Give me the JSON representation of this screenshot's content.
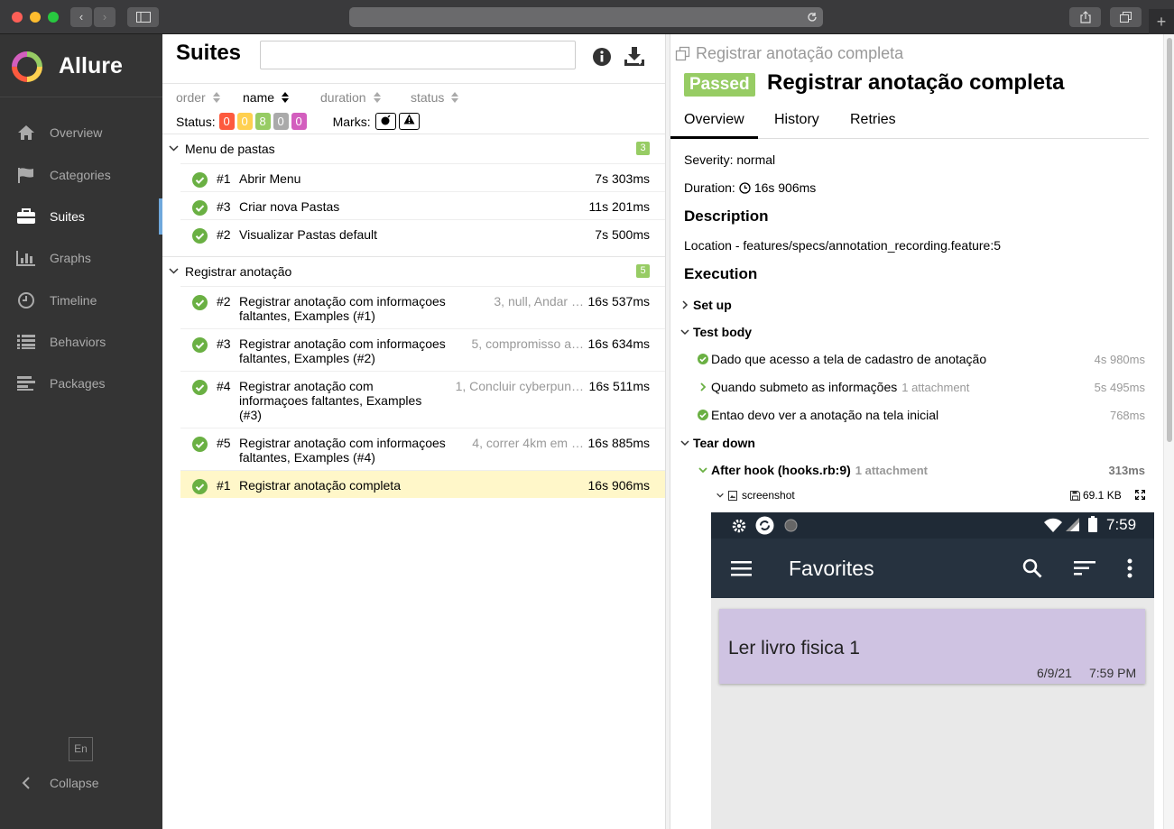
{
  "sidebar": {
    "app_name": "Allure",
    "items": [
      {
        "label": "Overview",
        "icon": "home-icon"
      },
      {
        "label": "Categories",
        "icon": "flag-icon"
      },
      {
        "label": "Suites",
        "icon": "briefcase-icon"
      },
      {
        "label": "Graphs",
        "icon": "bar-chart-icon"
      },
      {
        "label": "Timeline",
        "icon": "clock-icon"
      },
      {
        "label": "Behaviors",
        "icon": "list-icon"
      },
      {
        "label": "Packages",
        "icon": "align-left-icon"
      }
    ],
    "active": "Suites",
    "lang": "En",
    "collapse": "Collapse"
  },
  "suites": {
    "title": "Suites",
    "search_value": "",
    "sort": {
      "order": "order",
      "name": "name",
      "duration": "duration",
      "status": "status"
    },
    "status_label": "Status:",
    "status_counts": [
      {
        "value": "0",
        "color": "#fd5a3e"
      },
      {
        "value": "0",
        "color": "#ffd050"
      },
      {
        "value": "8",
        "color": "#97cc64"
      },
      {
        "value": "0",
        "color": "#aaaaaa"
      },
      {
        "value": "0",
        "color": "#d35ebe"
      }
    ],
    "marks_label": "Marks:",
    "groups": [
      {
        "name": "Menu de pastas",
        "count": "3",
        "rows": [
          {
            "num": "#1",
            "name": "Abrir Menu",
            "params": "",
            "duration": "7s 303ms"
          },
          {
            "num": "#3",
            "name": "Criar nova Pastas",
            "params": "",
            "duration": "11s 201ms"
          },
          {
            "num": "#2",
            "name": "Visualizar Pastas default",
            "params": "",
            "duration": "7s 500ms"
          }
        ]
      },
      {
        "name": "Registrar anotação",
        "count": "5",
        "rows": [
          {
            "num": "#2",
            "name": "Registrar anotação com informaçoes faltantes, Examples (#1)",
            "params": "3, null, Andar …",
            "duration": "16s 537ms"
          },
          {
            "num": "#3",
            "name": "Registrar anotação com informaçoes faltantes, Examples (#2)",
            "params": "5, compromisso a…",
            "duration": "16s 634ms"
          },
          {
            "num": "#4",
            "name": "Registrar anotação com informaçoes faltantes, Examples (#3)",
            "params": "1, Concluir cyberpun…",
            "duration": "16s 511ms"
          },
          {
            "num": "#5",
            "name": "Registrar anotação com informaçoes faltantes, Examples (#4)",
            "params": "4, correr 4km em …",
            "duration": "16s 885ms"
          },
          {
            "num": "#1",
            "name": "Registrar anotação completa",
            "params": "",
            "duration": "16s 906ms"
          }
        ]
      }
    ]
  },
  "detail": {
    "breadcrumb": "Registrar anotação completa",
    "status": "Passed",
    "title": "Registrar anotação completa",
    "tabs": [
      "Overview",
      "History",
      "Retries"
    ],
    "severity": "Severity: normal",
    "duration_label": "Duration:",
    "duration_value": "16s 906ms",
    "description_heading": "Description",
    "description": "Location - features/specs/annotation_recording.feature:5",
    "execution_heading": "Execution",
    "setup": "Set up",
    "test_body": "Test body",
    "steps": [
      {
        "name": "Dado que acesso a tela de cadastro de anotação",
        "attachment": "",
        "duration": "4s 980ms"
      },
      {
        "name": "Quando submeto as informações",
        "attachment": "1 attachment",
        "duration": "5s 495ms"
      },
      {
        "name": "Entao devo ver a anotação na tela inicial",
        "attachment": "",
        "duration": "768ms"
      }
    ],
    "tear_down": "Tear down",
    "after_hook": "After hook (hooks.rb:9)",
    "after_hook_attachment": "1 attachment",
    "after_hook_duration": "313ms",
    "screenshot_label": "screenshot",
    "screenshot_size": "69.1 KB",
    "phone": {
      "time": "7:59",
      "toolbar_title": "Favorites",
      "card_title": "Ler livro fisica 1",
      "card_date": "6/9/21",
      "card_time": "7:59 PM"
    }
  }
}
